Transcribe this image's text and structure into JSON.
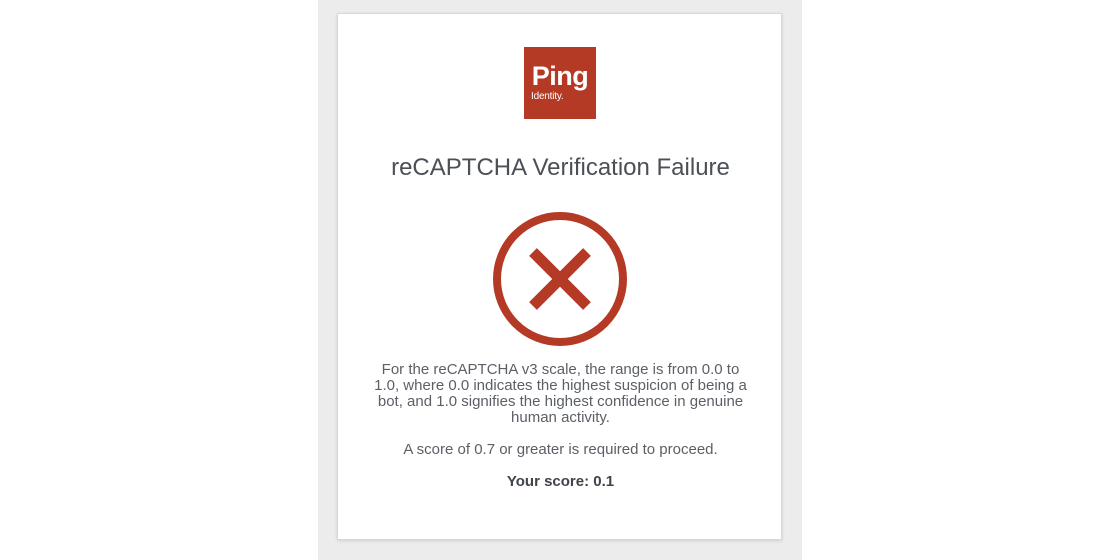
{
  "logo": {
    "main_text": "Ping",
    "sub_text": "Identity."
  },
  "title": "reCAPTCHA Verification Failure",
  "status": {
    "icon_name": "error-x-icon",
    "color": "#b43a26"
  },
  "message": {
    "explanation": "For the reCAPTCHA v3 scale, the range is from 0.0 to 1.0, where 0.0 indicates the highest suspicion of being a bot, and 1.0 signifies the highest confidence in genuine human activity.",
    "requirement": "A score of 0.7 or greater is required to proceed.",
    "score": "Your score: 0.1"
  },
  "colors": {
    "brand": "#b43a26",
    "text": "#5b5f66",
    "backdrop": "#ececec"
  }
}
